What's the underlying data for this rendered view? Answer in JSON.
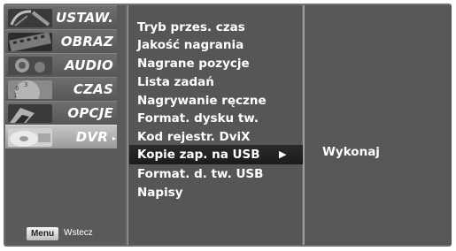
{
  "sidebar": {
    "items": [
      {
        "label": "USTAW.",
        "icon": "satellite-dish-icon",
        "selected": false
      },
      {
        "label": "OBRAZ",
        "icon": "film-strip-icon",
        "selected": false
      },
      {
        "label": "AUDIO",
        "icon": "speaker-icon",
        "selected": false
      },
      {
        "label": "CZAS",
        "icon": "clock-icon",
        "selected": false
      },
      {
        "label": "OPCJE",
        "icon": "special-icon",
        "selected": false
      },
      {
        "label": "DVR",
        "icon": "disc-icon",
        "selected": true,
        "arrow": "▸"
      }
    ]
  },
  "footer": {
    "menu_key": "Menu",
    "back_label": "Wstecz"
  },
  "submenu": {
    "items": [
      {
        "label": "Tryb przes. czas"
      },
      {
        "label": "Jakość nagrania"
      },
      {
        "label": "Nagrane pozycje"
      },
      {
        "label": "Lista zadań"
      },
      {
        "label": "Nagrywanie ręczne"
      },
      {
        "label": "Format. dysku tw."
      },
      {
        "label": "Kod rejestr. DviX"
      },
      {
        "label": "Kopie zap. na USB",
        "selected": true
      },
      {
        "label": "Format. d. tw. USB"
      },
      {
        "label": "Napisy"
      }
    ],
    "selected_arrow": "▶"
  },
  "action_panel": {
    "label": "Wykonaj"
  },
  "colors": {
    "frame": "#6f6f6f",
    "panel": "#565656",
    "highlight": "#1b1b1b",
    "text": "#ffffff"
  }
}
